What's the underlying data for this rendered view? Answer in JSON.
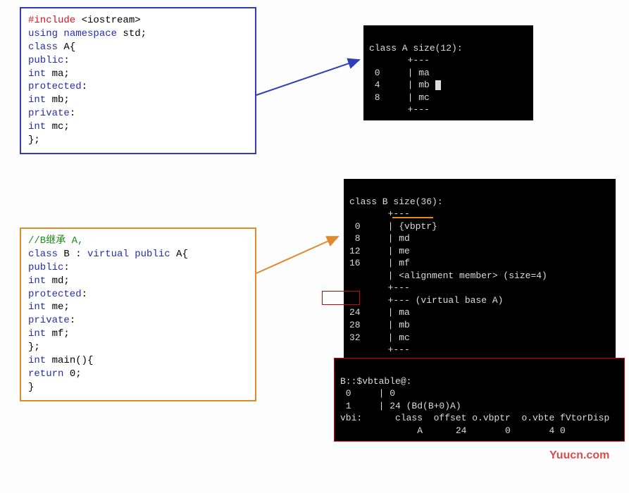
{
  "code_a": {
    "l1a": "#include",
    "l1b": " <iostream>",
    "l2a": "using",
    "l2b": " namespace",
    "l2c": " std;",
    "l3": "",
    "l4a": "class",
    "l4b": "  A{",
    "l5": "",
    "l6a": "public",
    "l6b": ":",
    "l7a": "    int",
    "l7b": " ma;",
    "l8": "",
    "l9a": "protected",
    "l9b": ":",
    "l10a": "    int",
    "l10b": " mb;",
    "l11a": "private",
    "l11b": ":",
    "l12a": "    int",
    "l12b": " mc;",
    "l13": "",
    "l14": "};"
  },
  "code_b": {
    "l1": "//B继承 A,",
    "l2a": "class",
    "l2b": " B : ",
    "l2c": "virtual",
    "l2d": " public",
    "l2e": " A{",
    "l3a": "public",
    "l3b": ":",
    "l4a": "    int",
    "l4b": " md;",
    "l5a": "protected",
    "l5b": ":",
    "l6a": "    int",
    "l6b": " me;",
    "l7a": "private",
    "l7b": ":",
    "l8a": "    int",
    "l8b": " mf;",
    "l9": "};",
    "l10": "",
    "l11a": "int",
    "l11b": " main(){",
    "l12": "",
    "l13a": "    return",
    "l13b": " 0;",
    "l14": "",
    "l15": "}"
  },
  "term_a": {
    "header": "class A size(12):",
    "sep1": "       +---",
    "r0": " 0     | ma",
    "r1": " 4     | mb",
    "r2": " 8     | mc",
    "sep2": "       +---"
  },
  "term_b": {
    "header": "class B size(36):",
    "sep1": "       +---",
    "r0": " 0     | {vbptr}",
    "r1": " 8     | md",
    "r2": "12     | me",
    "r3": "16     | mf",
    "r4": "       | <alignment member> (size=4)",
    "sep2": "       +---",
    "sep3": "       +--- (virtual base A)",
    "r5": "24     | ma",
    "r6": "28     | mb",
    "r7": "32     | mc",
    "sep4": "       +---"
  },
  "term_c": {
    "l1": "B::$vbtable@:",
    "l2": " 0     | 0",
    "l3": " 1     | 24 (Bd(B+0)A)",
    "l4": "vbi:      class  offset o.vbptr  o.vbte fVtorDisp",
    "l5": "              A      24       0       4 0"
  },
  "watermark": "Yuucn.com"
}
